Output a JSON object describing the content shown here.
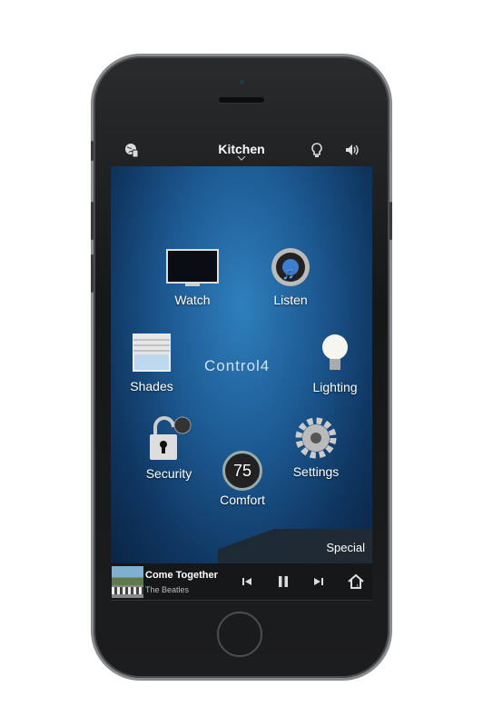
{
  "header": {
    "room_title": "Kitchen",
    "icons": [
      "globe-device-icon",
      "lightbulb-icon",
      "speaker-volume-icon"
    ]
  },
  "tiles": {
    "watch": "Watch",
    "listen": "Listen",
    "shades": "Shades",
    "lighting": "Lighting",
    "security": "Security",
    "settings": "Settings",
    "comfort": "Comfort",
    "comfort_temp": "75"
  },
  "brand_logo": "Control4",
  "special_label": "Special",
  "now_playing": {
    "title": "Come Together",
    "artist": "The Beatles",
    "controls": [
      "previous-icon",
      "pause-icon",
      "next-icon",
      "home-icon"
    ]
  },
  "colors": {
    "screen_bg": "#1d5a93",
    "bar_bg": "#161718"
  }
}
